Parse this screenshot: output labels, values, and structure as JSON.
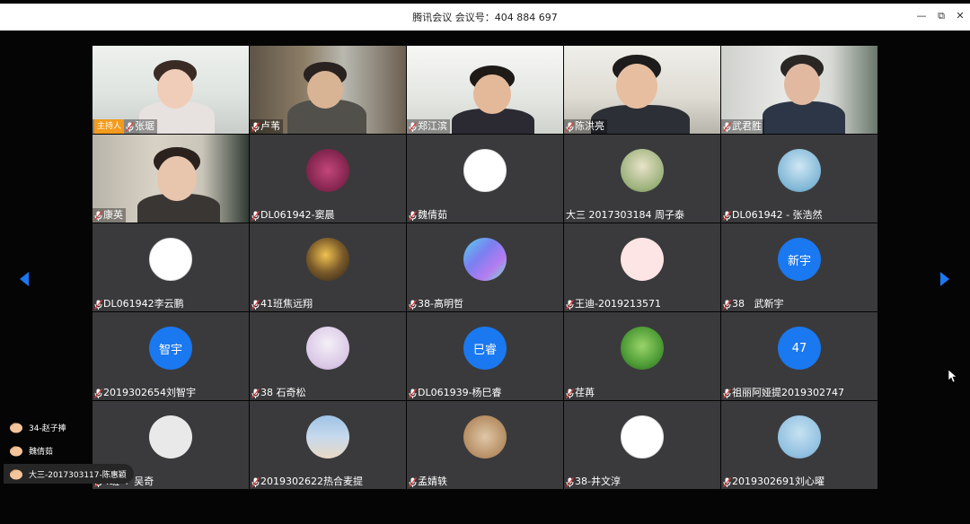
{
  "window": {
    "title": "腾讯会议 会议号：404 884 697",
    "min_icon": "—",
    "max_icon": "⧉",
    "close_icon": "✕"
  },
  "participants": [
    {
      "name": "张琚",
      "host_badge": "主持人",
      "type": "video",
      "video": "v0"
    },
    {
      "name": "卢苇",
      "type": "video",
      "video": "v1"
    },
    {
      "name": "郑江滨",
      "type": "video",
      "video": "v2"
    },
    {
      "name": "陈洪亮",
      "type": "video",
      "video": "v3"
    },
    {
      "name": "武君胜",
      "type": "video",
      "video": "v4"
    },
    {
      "name": "康英",
      "type": "video",
      "video": "v5"
    },
    {
      "name": "DL061942-窦晨",
      "type": "avatar",
      "avatar": "av-rose"
    },
    {
      "name": "魏倩茹",
      "type": "avatar",
      "avatar": "av-meme"
    },
    {
      "name": "大三 2017303184 周子泰",
      "type": "avatar",
      "avatar": "av-puffin",
      "no_mic": true
    },
    {
      "name": "DL061942 - 张浩然",
      "type": "avatar",
      "avatar": "av-boy"
    },
    {
      "name": "DL061942李云鹏",
      "type": "avatar",
      "avatar": "av-duck"
    },
    {
      "name": "41班焦远翔",
      "type": "avatar",
      "avatar": "av-paint"
    },
    {
      "name": "38-高明哲",
      "type": "avatar",
      "avatar": "av-holo"
    },
    {
      "name": "王迪-2019213571",
      "type": "avatar",
      "avatar": "av-bird"
    },
    {
      "name": "38   武新宇",
      "type": "avatar",
      "avatar": "text",
      "avatar_text": "新宇"
    },
    {
      "name": "2019302654刘智宇",
      "type": "avatar",
      "avatar": "text",
      "avatar_text": "智宇"
    },
    {
      "name": "38 石奇松",
      "type": "avatar",
      "avatar": "av-anime"
    },
    {
      "name": "DL061939-杨巳睿",
      "type": "avatar",
      "avatar": "text",
      "avatar_text": "巳睿"
    },
    {
      "name": "荏苒",
      "type": "avatar",
      "avatar": "av-nature"
    },
    {
      "name": "祖丽阿娅提2019302747",
      "type": "avatar",
      "avatar": "text",
      "avatar_text": "47"
    },
    {
      "name": "4班 + 吴奇",
      "type": "avatar",
      "avatar": "av-default"
    },
    {
      "name": "2019302622热合麦提",
      "type": "avatar",
      "avatar": "av-sky"
    },
    {
      "name": "孟婧轶",
      "type": "avatar",
      "avatar": "av-hamster"
    },
    {
      "name": "38-井文淳",
      "type": "avatar",
      "avatar": "av-girl"
    },
    {
      "name": "2019302691刘心曜",
      "type": "avatar",
      "avatar": "av-mask"
    }
  ],
  "hand_raises": [
    {
      "text": "34-赵子捧"
    },
    {
      "text": "魏倩茹"
    },
    {
      "text": "大三-2017303117-陈惠颖"
    }
  ],
  "colors": {
    "accent": "#1a78f0",
    "host_badge": "#f29b1d",
    "tile_bg": "#3a3a3c"
  }
}
